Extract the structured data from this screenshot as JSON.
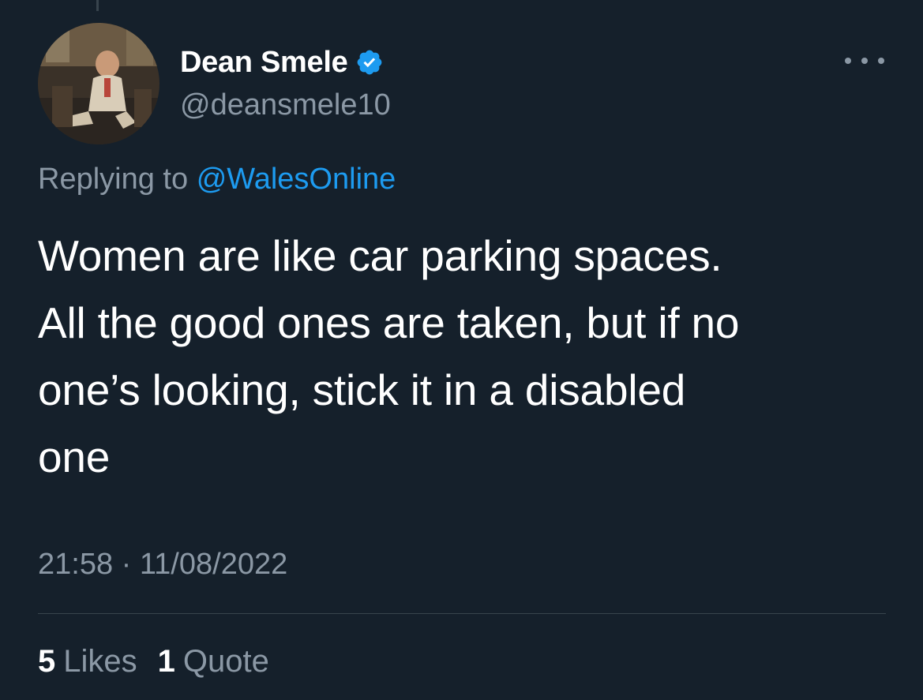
{
  "author": {
    "display_name": "Dean Smele",
    "handle": "@deansmele10",
    "verified": true,
    "avatar_icon": "profile-photo"
  },
  "reply": {
    "prefix": "Replying to",
    "mention": "@WalesOnline"
  },
  "tweet": {
    "lines": [
      "Women are like car parking spaces.",
      "All the good ones are taken, but if no",
      "one’s looking, stick it in a disabled",
      "one"
    ]
  },
  "meta": {
    "timestamp": "21:58 · 11/08/2022"
  },
  "stats": {
    "likes_count": "5",
    "likes_label": "Likes",
    "quotes_count": "1",
    "quotes_label": "Quote"
  },
  "colors": {
    "background": "#15202b",
    "primary_text": "#ffffff",
    "secondary_text": "#8b98a5",
    "accent": "#1d9bf0",
    "divider": "#38444d"
  }
}
